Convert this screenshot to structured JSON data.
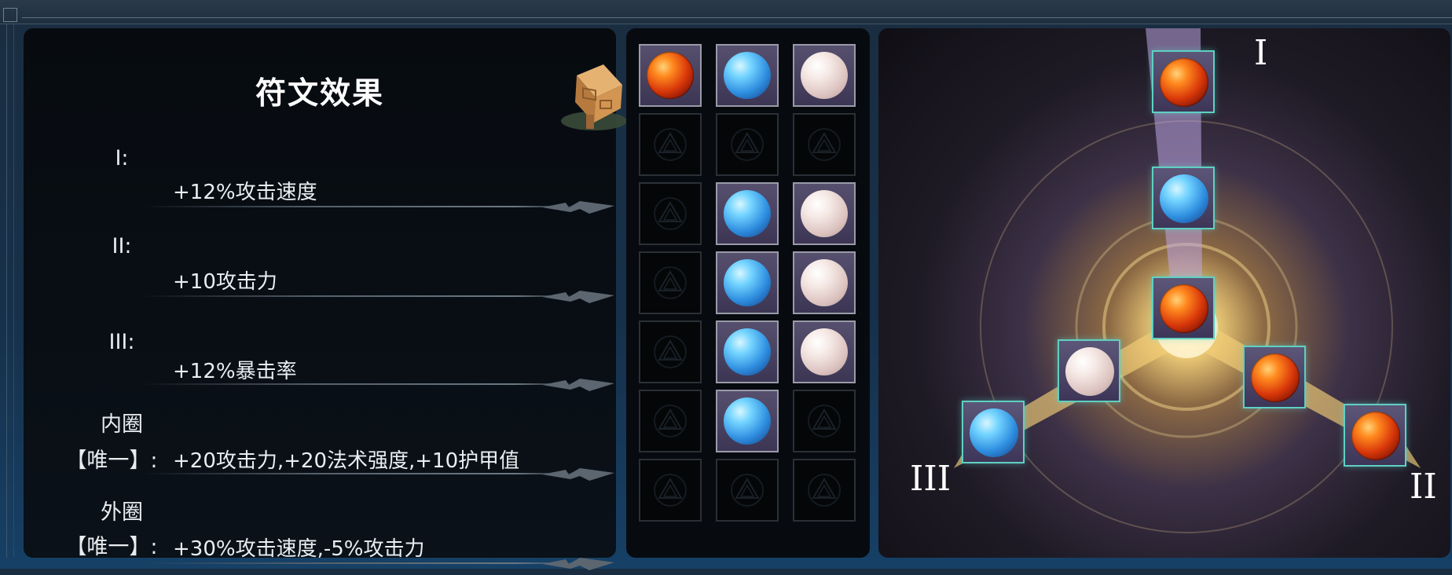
{
  "effects": {
    "title": "符文效果",
    "icon": "rune-book-icon",
    "rows": [
      {
        "label": "I:",
        "text": "+12%攻击速度"
      },
      {
        "label": "II:",
        "text": "+10攻击力"
      },
      {
        "label": "III:",
        "text": "+12%暴击率"
      },
      {
        "label_line1": "内圈",
        "label_line2": "【唯一】:",
        "text": "+20攻击力,+20法术强度,+10护甲值"
      },
      {
        "label_line1": "外圈",
        "label_line2": "【唯一】:",
        "text": "+30%攻击速度,-5%攻击力"
      }
    ]
  },
  "inventory": {
    "grid": [
      [
        "red",
        "blue",
        "pearl"
      ],
      [
        "empty",
        "empty",
        "empty"
      ],
      [
        "empty",
        "blue",
        "pearl"
      ],
      [
        "empty",
        "blue",
        "pearl"
      ],
      [
        "empty",
        "blue",
        "pearl"
      ],
      [
        "empty",
        "blue",
        "empty"
      ],
      [
        "empty",
        "empty",
        "empty"
      ]
    ]
  },
  "board": {
    "branch_labels": {
      "top": "I",
      "right": "II",
      "left": "III"
    },
    "slots": [
      {
        "gem": "red"
      },
      {
        "gem": "blue"
      },
      {
        "gem": "red"
      },
      {
        "gem": "pearl"
      },
      {
        "gem": "red"
      },
      {
        "gem": "blue"
      },
      {
        "gem": "red"
      }
    ]
  },
  "colors": {
    "gem_red": "#d9380a",
    "gem_blue": "#2f8fe0",
    "gem_pearl": "#e6d1ce",
    "slot_border": "#5fd0c2",
    "panel_bg": "#070b10"
  }
}
